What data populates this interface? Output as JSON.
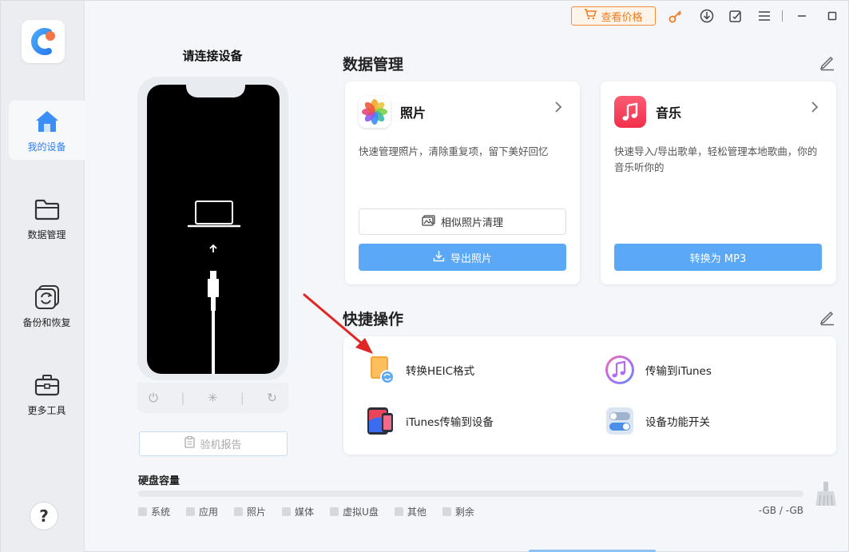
{
  "topbar": {
    "price_label": "查看价格",
    "icons": [
      "cart-icon",
      "key-icon",
      "download-icon",
      "feedback-icon",
      "menu-icon",
      "minimize-icon",
      "maximize-icon"
    ]
  },
  "sidebar": {
    "items": [
      {
        "label": "我的设备",
        "icon": "home-icon",
        "active": true
      },
      {
        "label": "数据管理",
        "icon": "folder-icon",
        "active": false
      },
      {
        "label": "备份和恢复",
        "icon": "backup-icon",
        "active": false
      },
      {
        "label": "更多工具",
        "icon": "toolbox-icon",
        "active": false
      }
    ],
    "help_label": "?"
  },
  "device": {
    "title": "请连接设备",
    "report_label": "验机报告"
  },
  "data_management": {
    "title": "数据管理",
    "cards": [
      {
        "title": "照片",
        "description": "快速管理照片，清除重复项，留下美好回忆",
        "secondary_button": "相似照片清理",
        "primary_button": "导出照片"
      },
      {
        "title": "音乐",
        "description": "快速导入/导出歌单，轻松管理本地歌曲，你的音乐听你的",
        "primary_button": "转换为 MP3"
      }
    ]
  },
  "quick_actions": {
    "title": "快捷操作",
    "items": [
      {
        "label": "转换HEIC格式",
        "icon": "heic-convert-icon"
      },
      {
        "label": "传输到iTunes",
        "icon": "itunes-icon"
      },
      {
        "label": "iTunes传输到设备",
        "icon": "itunes-to-device-icon"
      },
      {
        "label": "设备功能开关",
        "icon": "toggle-icon"
      }
    ]
  },
  "storage": {
    "title": "硬盘容量",
    "legend": [
      "系统",
      "应用",
      "照片",
      "媒体",
      "虚拟U盘",
      "其他",
      "剩余"
    ],
    "value": "-GB / -GB"
  },
  "colors": {
    "accent_blue": "#5ba8f7",
    "active_nav": "#2c7ef8",
    "price_orange": "#ef7a1f",
    "annotation_red": "#e02525"
  }
}
